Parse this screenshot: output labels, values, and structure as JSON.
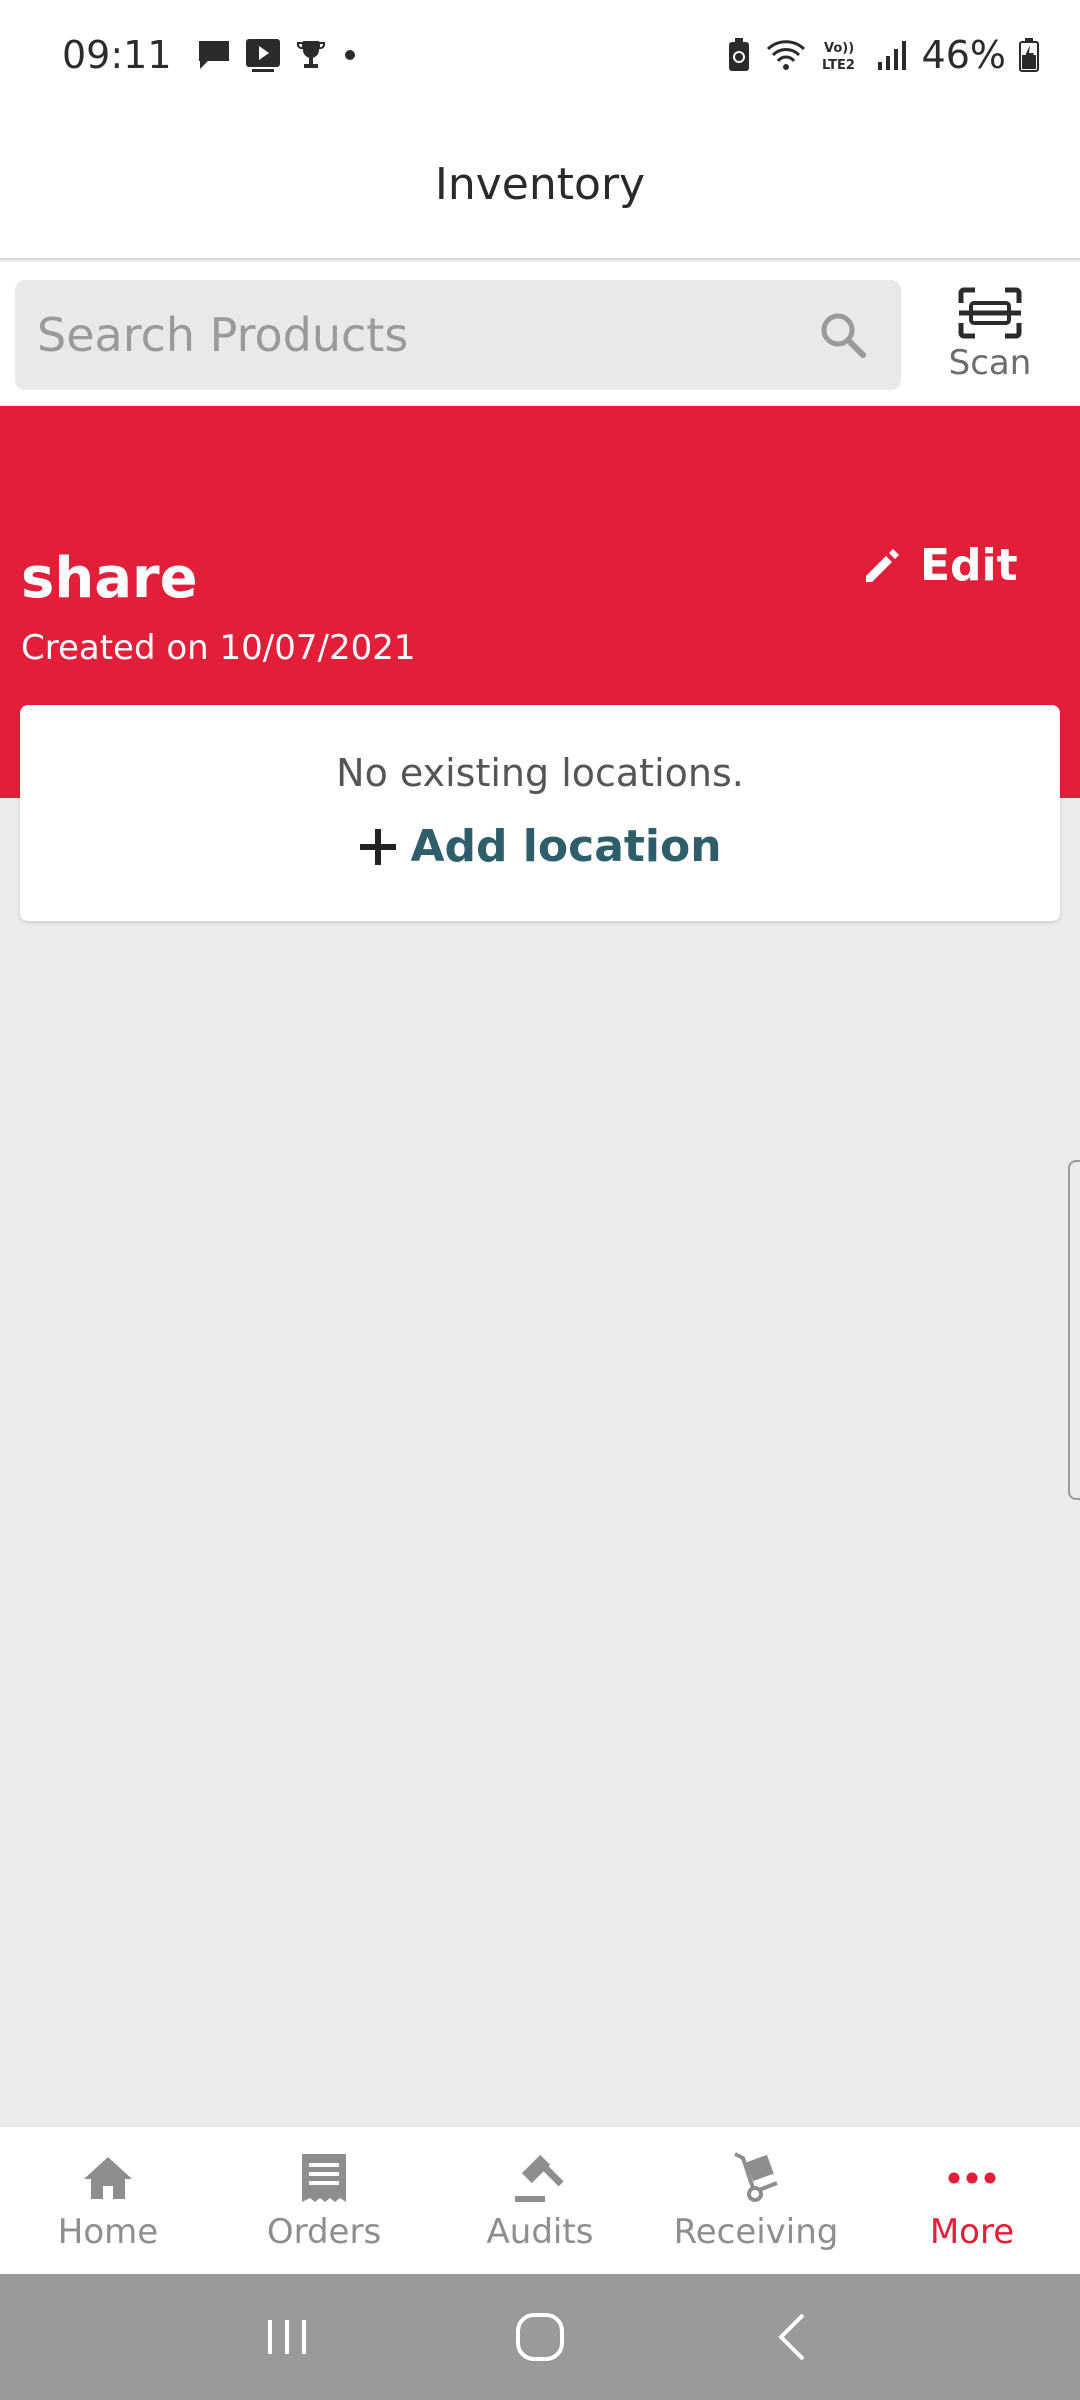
{
  "status_bar": {
    "time": "09:11",
    "battery": "46%",
    "icons": [
      "message-icon",
      "media-icon",
      "trophy-icon",
      "dot-icon",
      "battery-saver-icon",
      "wifi-icon",
      "volte-icon",
      "signal-icon",
      "battery-icon"
    ]
  },
  "app_bar": {
    "title": "Inventory"
  },
  "search": {
    "placeholder": "Search Products",
    "value": "",
    "scan_label": "Scan"
  },
  "item": {
    "name": "share",
    "created": "Created on 10/07/2021",
    "edit_label": "Edit"
  },
  "locations": {
    "empty_text": "No existing locations.",
    "add_label": "Add location"
  },
  "bottom_nav": {
    "items": [
      {
        "label": "Home",
        "icon": "home-icon",
        "active": false
      },
      {
        "label": "Orders",
        "icon": "orders-icon",
        "active": false
      },
      {
        "label": "Audits",
        "icon": "audits-icon",
        "active": false
      },
      {
        "label": "Receiving",
        "icon": "receiving-icon",
        "active": false
      },
      {
        "label": "More",
        "icon": "more-icon",
        "active": true
      }
    ]
  },
  "colors": {
    "brand_red": "#e31e38",
    "link_teal": "#2f5e6b",
    "nav_inactive": "#8e8e8e",
    "background": "#ebebeb"
  }
}
